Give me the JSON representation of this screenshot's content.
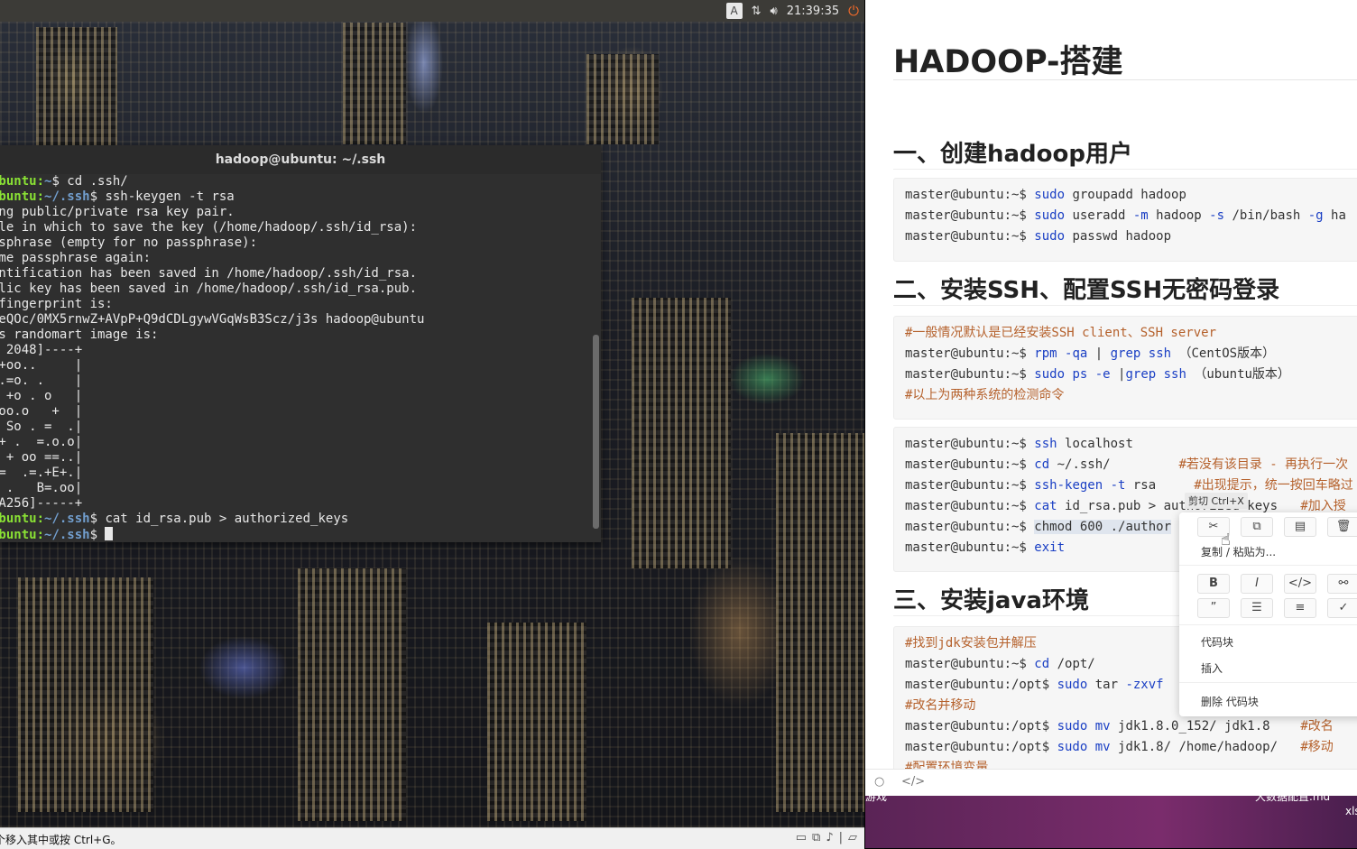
{
  "vm": {
    "topbar": {
      "keyboard_indicator": "A",
      "clock": "21:39:35",
      "icons": [
        "network-icon",
        "volume-icon",
        "power-icon"
      ]
    },
    "terminal": {
      "title": "hadoop@ubuntu: ~/.ssh",
      "lines": [
        {
          "user": "ubuntu:",
          "path": "~",
          "tail": "$ cd .ssh/"
        },
        {
          "user": "ubuntu:",
          "path": "~/.ssh",
          "tail": "$ ssh-keygen -t rsa"
        },
        {
          "text": "ing public/private rsa key pair."
        },
        {
          "text": "ile in which to save the key (/home/hadoop/.ssh/id_rsa):"
        },
        {
          "text": "ssphrase (empty for no passphrase):"
        },
        {
          "text": "ame passphrase again:"
        },
        {
          "text": "entification has been saved in /home/hadoop/.ssh/id_rsa."
        },
        {
          "text": "blic key has been saved in /home/hadoop/.ssh/id_rsa.pub."
        },
        {
          "text": " fingerprint is:"
        },
        {
          "text": "5eQOc/0MX5rnwZ+AVpP+Q9dCDLgywVGqWsB3Scz/j3s hadoop@ubuntu"
        },
        {
          "text": "'s randomart image is:"
        },
        {
          "text": "A 2048]----+"
        },
        {
          "text": " +oo..     |"
        },
        {
          "text": " .=o. .    |"
        },
        {
          "text": ". +o . o   |"
        },
        {
          "text": " oo.o   +  |"
        },
        {
          "text": "o So . =  .|"
        },
        {
          "text": " + .  =.o.o|"
        },
        {
          "text": "o + oo ==..|"
        },
        {
          "text": " =  .=.+E+.|"
        },
        {
          "text": "  .   B=.oo|"
        },
        {
          "text": "HA256]-----+"
        },
        {
          "user": "ubuntu:",
          "path": "~/.ssh",
          "tail": "$ cat id_rsa.pub > authorized_keys"
        },
        {
          "user": "ubuntu:",
          "path": "~/.ssh",
          "tail": "$ ",
          "cursor": true
        }
      ]
    },
    "status_bar": {
      "message": "个移入其中或按 Ctrl+G。"
    }
  },
  "editor": {
    "h1": "HADOOP-搭建",
    "sections": [
      {
        "heading": "一、创建hadoop用户",
        "blocks": [
          [
            [
              [
                "master@ubuntu:~$ ",
                ""
              ],
              [
                "sudo",
                "kw"
              ],
              [
                " groupadd hadoop",
                ""
              ]
            ],
            [
              [
                "master@ubuntu:~$ ",
                ""
              ],
              [
                "sudo",
                "kw"
              ],
              [
                " useradd ",
                ""
              ],
              [
                "-m",
                "kw"
              ],
              [
                " hadoop ",
                ""
              ],
              [
                "-s",
                "kw"
              ],
              [
                " /bin/bash ",
                ""
              ],
              [
                "-g",
                "kw"
              ],
              [
                " ha",
                ""
              ]
            ],
            [
              [
                "master@ubuntu:~$ ",
                ""
              ],
              [
                "sudo",
                "kw"
              ],
              [
                " passwd hadoop",
                ""
              ]
            ]
          ]
        ]
      },
      {
        "heading": "二、安装SSH、配置SSH无密码登录",
        "blocks": [
          [
            [
              [
                "#一般情况默认是已经安装SSH client、SSH server",
                "cm"
              ]
            ],
            [
              [
                "master@ubuntu:~$ ",
                ""
              ],
              [
                "rpm",
                "kw"
              ],
              [
                " ",
                ""
              ],
              [
                "-qa",
                "kw"
              ],
              [
                " | ",
                ""
              ],
              [
                "grep",
                "kw"
              ],
              [
                " ",
                ""
              ],
              [
                "ssh",
                "kw"
              ],
              [
                " （CentOS版本）",
                ""
              ]
            ],
            [
              [
                "master@ubuntu:~$ ",
                ""
              ],
              [
                "sudo",
                "kw"
              ],
              [
                " ",
                ""
              ],
              [
                "ps",
                "kw"
              ],
              [
                " ",
                ""
              ],
              [
                "-e",
                "kw"
              ],
              [
                " |",
                ""
              ],
              [
                "grep",
                "kw"
              ],
              [
                " ",
                ""
              ],
              [
                "ssh",
                "kw"
              ],
              [
                " （ubuntu版本）",
                ""
              ]
            ],
            [
              [
                "#以上为两种系统的检测命令",
                "cm"
              ]
            ]
          ],
          [
            [
              [
                "master@ubuntu:~$ ",
                ""
              ],
              [
                "ssh",
                "kw"
              ],
              [
                " localhost",
                ""
              ]
            ],
            [
              [
                "master@ubuntu:~$ ",
                ""
              ],
              [
                "cd",
                "kw"
              ],
              [
                " ~/.ssh/         ",
                ""
              ],
              [
                "#若没有该目录 - 再执行一次",
                "cm"
              ]
            ],
            [
              [
                "master@ubuntu:~$ ",
                ""
              ],
              [
                "ssh-kegen",
                "kw"
              ],
              [
                " ",
                ""
              ],
              [
                "-t",
                "kw"
              ],
              [
                " rsa     ",
                ""
              ],
              [
                "#出现提示，统一按回车略过",
                "cm"
              ]
            ],
            [
              [
                "master@ubuntu:~$ ",
                ""
              ],
              [
                "cat",
                "kw"
              ],
              [
                " id_rsa.pub > authorized_keys   ",
                ""
              ],
              [
                "#加入授",
                "cm"
              ]
            ],
            [
              [
                "master@ubuntu:~$ ",
                ""
              ],
              [
                "chmod 600 ./author",
                "sel"
              ]
            ],
            [
              [
                "master@ubuntu:~$ ",
                ""
              ],
              [
                "exit",
                "kw"
              ]
            ]
          ]
        ]
      },
      {
        "heading": "三、安装java环境",
        "blocks": [
          [
            [
              [
                "#找到jdk安装包并解压",
                "cm"
              ]
            ],
            [
              [
                "master@ubuntu:~$ ",
                ""
              ],
              [
                "cd",
                "kw"
              ],
              [
                " /opt/",
                ""
              ]
            ],
            [
              [
                "master@ubuntu:/opt$ ",
                ""
              ],
              [
                "sudo",
                "kw"
              ],
              [
                " tar ",
                ""
              ],
              [
                "-zxvf",
                "kw"
              ]
            ],
            [
              [
                "#改名并移动",
                "cm"
              ]
            ],
            [
              [
                "master@ubuntu:/opt$ ",
                ""
              ],
              [
                "sudo",
                "kw"
              ],
              [
                " ",
                ""
              ],
              [
                "mv",
                "kw"
              ],
              [
                " jdk1.8.0_152/ jdk1.8    ",
                ""
              ],
              [
                "#改名",
                "cm"
              ]
            ],
            [
              [
                "master@ubuntu:/opt$ ",
                ""
              ],
              [
                "sudo",
                "kw"
              ],
              [
                " ",
                ""
              ],
              [
                "mv",
                "kw"
              ],
              [
                " jdk1.8/ /home/hadoop/   ",
                ""
              ],
              [
                "#移动",
                "cm"
              ]
            ],
            [
              [
                "#配置环境变量",
                "cm"
              ]
            ]
          ]
        ]
      }
    ],
    "context_menu": {
      "tooltip": "剪切 Ctrl+X",
      "row1_icons": [
        "cut-icon",
        "copy-icon",
        "paste-icon",
        "delete-icon"
      ],
      "copy_paste_as": "复制 / 粘贴为...",
      "format_icons": [
        "B",
        "I",
        "</>",
        "⚯"
      ],
      "format_icons2": [
        "”",
        "☰",
        "≡",
        "✓"
      ],
      "code_block": "代码块",
      "insert": "插入",
      "delete_code_block": "删除 代码块"
    },
    "footer_icons": [
      "○",
      "</>"
    ]
  },
  "desktop_right": {
    "label1": "游戏",
    "label2": "大数据配置.md",
    "label3": "xls"
  }
}
